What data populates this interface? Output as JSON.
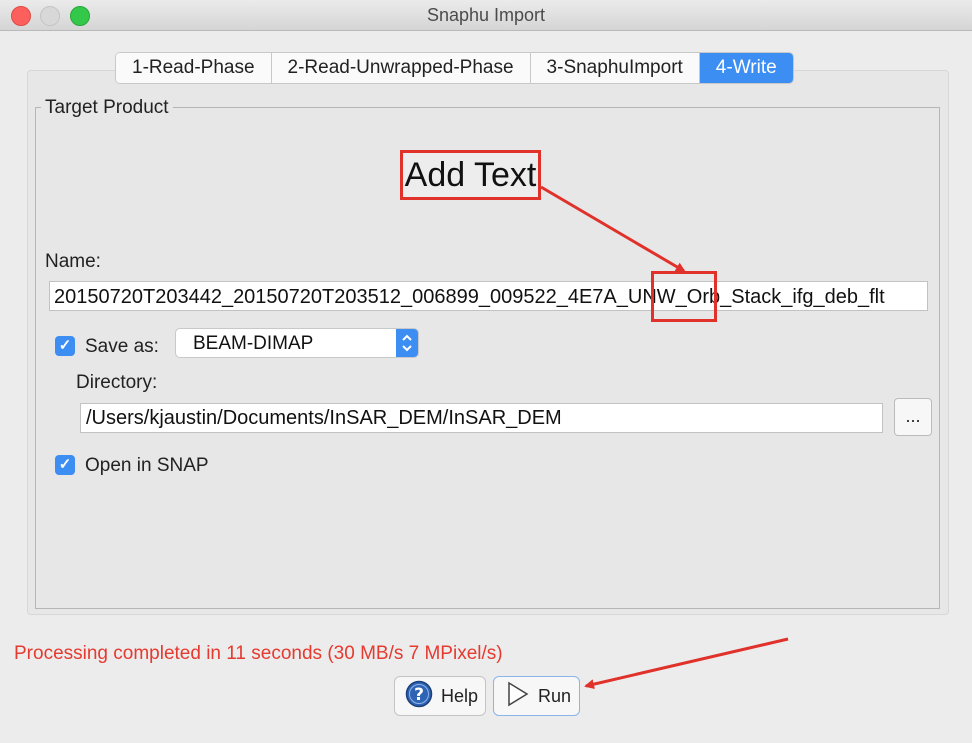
{
  "window": {
    "title": "Snaphu Import"
  },
  "tabs": [
    {
      "label": "1-Read-Phase",
      "active": false
    },
    {
      "label": "2-Read-Unwrapped-Phase",
      "active": false
    },
    {
      "label": "3-SnaphuImport",
      "active": false
    },
    {
      "label": "4-Write",
      "active": true
    }
  ],
  "target_product": {
    "group_title": "Target Product",
    "name_label": "Name:",
    "name_value": "20150720T203442_20150720T203512_006899_009522_4E7A_UNW_Orb_Stack_ifg_deb_flt",
    "save_as": {
      "label": "Save as:",
      "checked": true,
      "format": "BEAM-DIMAP"
    },
    "directory_label": "Directory:",
    "directory_value": "/Users/kjaustin/Documents/InSAR_DEM/InSAR_DEM",
    "browse_label": "...",
    "open_in_snap": {
      "label": "Open in SNAP",
      "checked": true
    }
  },
  "annotation": {
    "text": "Add Text",
    "color": "#e0312b"
  },
  "status": {
    "text": "Processing completed in 11 seconds (30 MB/s 7 MPixel/s)",
    "color": "#e53a2f"
  },
  "buttons": {
    "help_label": "Help",
    "run_label": "Run"
  },
  "colors": {
    "accent": "#3d8ef3",
    "window_bg": "#ececec"
  }
}
